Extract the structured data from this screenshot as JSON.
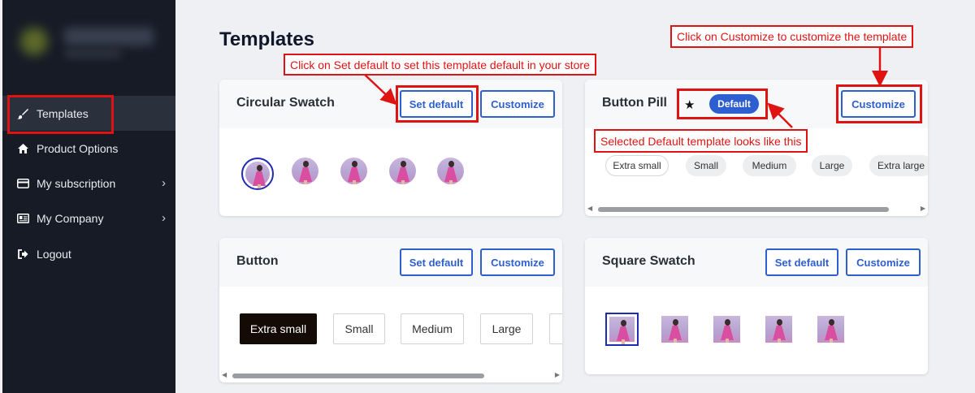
{
  "sidebar": {
    "items": [
      {
        "label": "Templates",
        "icon": "paint-brush-icon"
      },
      {
        "label": "Product Options",
        "icon": "home-icon"
      },
      {
        "label": "My subscription",
        "icon": "credit-card-icon",
        "chevron": "›"
      },
      {
        "label": "My Company",
        "icon": "id-card-icon",
        "chevron": "›"
      },
      {
        "label": "Logout",
        "icon": "logout-icon"
      }
    ]
  },
  "page": {
    "title": "Templates"
  },
  "cards": {
    "circular": {
      "title": "Circular Swatch",
      "set_default": "Set default",
      "customize": "Customize"
    },
    "pill": {
      "title": "Button Pill",
      "default_badge": "Default",
      "customize": "Customize",
      "sizes": [
        "Extra small",
        "Small",
        "Medium",
        "Large",
        "Extra large"
      ]
    },
    "button": {
      "title": "Button",
      "set_default": "Set default",
      "customize": "Customize",
      "sizes": [
        "Extra small",
        "Small",
        "Medium",
        "Large"
      ]
    },
    "square": {
      "title": "Square Swatch",
      "set_default": "Set default",
      "customize": "Customize"
    }
  },
  "annotations": {
    "set_default": "Click on Set default to set this template default in your store",
    "customize": "Click on Customize to customize the template",
    "selected": "Selected Default template looks like this"
  },
  "colors": {
    "accent": "#2d5fd1",
    "annotation": "#e01313",
    "sidebar_bg": "#161b26"
  }
}
